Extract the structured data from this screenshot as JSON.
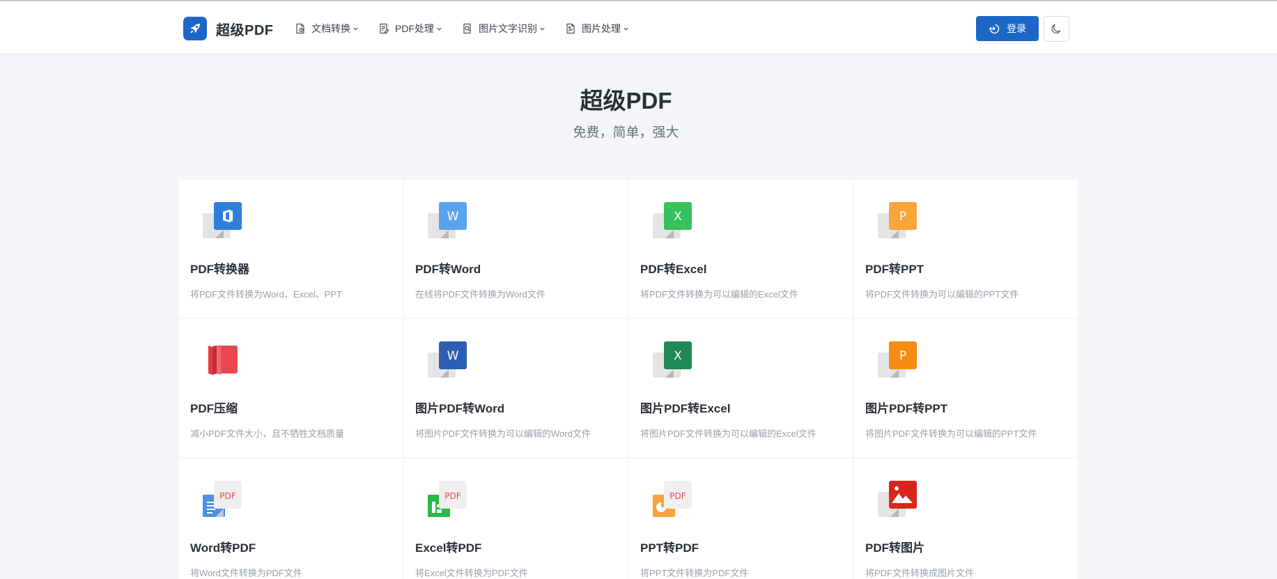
{
  "app": {
    "name": "超级PDF",
    "logo_icon": "rocket-icon",
    "brand_color": "#1e67c8"
  },
  "nav": [
    {
      "label": "文档转换",
      "icon": "document-convert-icon"
    },
    {
      "label": "PDF处理",
      "icon": "document-edit-icon"
    },
    {
      "label": "图片文字识别",
      "icon": "image-search-icon"
    },
    {
      "label": "图片处理",
      "icon": "image-file-icon"
    }
  ],
  "header": {
    "login_label": "登录",
    "login_icon": "login-icon",
    "theme_icon": "moon-icon"
  },
  "hero": {
    "title": "超级PDF",
    "subtitle": "免费，简单，强大"
  },
  "tools": [
    {
      "title": "PDF转换器",
      "desc": "将PDF文件转换为Word、Excel、PPT",
      "icon": "office-convert-icon",
      "icon_text": "",
      "color": "#2f7fd9"
    },
    {
      "title": "PDF转Word",
      "desc": "在线将PDF文件转换为Word文件",
      "icon": "pdf-to-word-icon",
      "icon_text": "W",
      "color": "#5aa2ee"
    },
    {
      "title": "PDF转Excel",
      "desc": "将PDF文件转换为可以编辑的Excel文件",
      "icon": "pdf-to-excel-icon",
      "icon_text": "X",
      "color": "#36c25c"
    },
    {
      "title": "PDF转PPT",
      "desc": "将PDF文件转换为可以编辑的PPT文件",
      "icon": "pdf-to-ppt-icon",
      "icon_text": "P",
      "color": "#f7a53d"
    },
    {
      "title": "PDF压缩",
      "desc": "减小PDF文件大小，且不牺牲文档质量",
      "icon": "compress-icon",
      "icon_text": "",
      "color": "#e8474f"
    },
    {
      "title": "图片PDF转Word",
      "desc": "将图片PDF文件转换为可以编辑的Word文件",
      "icon": "image-pdf-to-word-icon",
      "icon_text": "W",
      "color": "#2b5fb5"
    },
    {
      "title": "图片PDF转Excel",
      "desc": "将图片PDF文件转换为可以编辑的Excel文件",
      "icon": "image-pdf-to-excel-icon",
      "icon_text": "X",
      "color": "#1f8a55"
    },
    {
      "title": "图片PDF转PPT",
      "desc": "将图片PDF文件转换为可以编辑的PPT文件",
      "icon": "image-pdf-to-ppt-icon",
      "icon_text": "P",
      "color": "#f78a12"
    },
    {
      "title": "Word转PDF",
      "desc": "将Word文件转换为PDF文件",
      "icon": "word-to-pdf-icon",
      "icon_text": "PDF",
      "color": "#4d8ee8"
    },
    {
      "title": "Excel转PDF",
      "desc": "将Excel文件转换为PDF文件",
      "icon": "excel-to-pdf-icon",
      "icon_text": "PDF",
      "color": "#2cb64c"
    },
    {
      "title": "PPT转PDF",
      "desc": "将PPT文件转换为PDF文件",
      "icon": "ppt-to-pdf-icon",
      "icon_text": "PDF",
      "color": "#f7a53d"
    },
    {
      "title": "PDF转图片",
      "desc": "将PDF文件转换成图片文件",
      "icon": "pdf-to-image-icon",
      "icon_text": "",
      "color": "#d9251d"
    }
  ]
}
